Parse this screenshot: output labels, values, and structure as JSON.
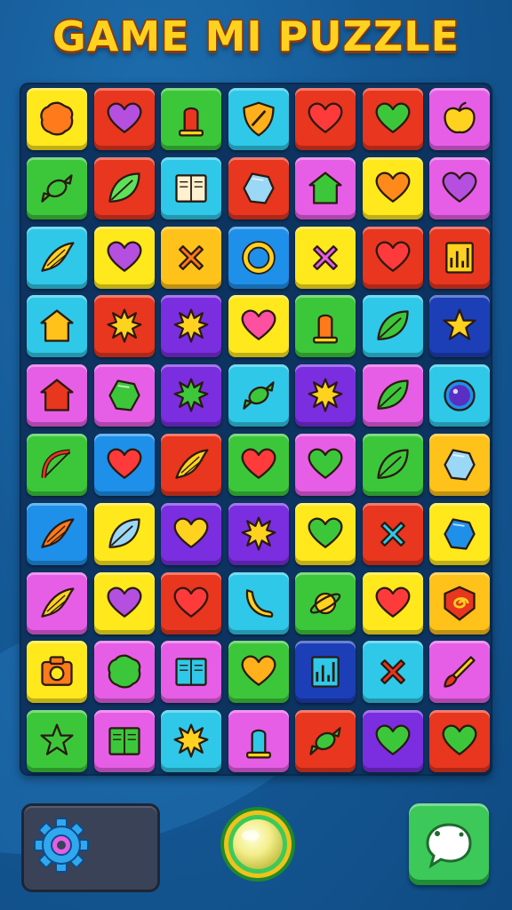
{
  "title": "GAME MI PUZZLE",
  "colors": {
    "yellow": "#ffe81c",
    "red": "#e8361f",
    "green": "#3cc73b",
    "cyan": "#2fc8e8",
    "magenta": "#e65ee6",
    "orange": "#ffc21a",
    "purple": "#7a2ee0",
    "blue": "#1e90ea",
    "navy": "#1c3fb8"
  },
  "grid": [
    [
      {
        "bg": "yellow",
        "icon": "blob-icon",
        "fg": "#ff7a1a"
      },
      {
        "bg": "red",
        "icon": "heart-icon",
        "fg": "#b44fe0"
      },
      {
        "bg": "green",
        "icon": "lamp-icon",
        "fg": "#e8361f"
      },
      {
        "bg": "cyan",
        "icon": "shield-icon",
        "fg": "#ffb01a"
      },
      {
        "bg": "red",
        "icon": "heart-icon",
        "fg": "#ff3a3a"
      },
      {
        "bg": "red",
        "icon": "heart-icon",
        "fg": "#3cc73b"
      },
      {
        "bg": "magenta",
        "icon": "apple-icon",
        "fg": "#ffd21f"
      }
    ],
    [
      {
        "bg": "green",
        "icon": "candy-icon",
        "fg": "#3cc73b"
      },
      {
        "bg": "red",
        "icon": "leaf-icon",
        "fg": "#5ee05a"
      },
      {
        "bg": "cyan",
        "icon": "book-icon",
        "fg": "#fff1d0"
      },
      {
        "bg": "red",
        "icon": "gem-icon",
        "fg": "#9ad8f5"
      },
      {
        "bg": "magenta",
        "icon": "house-icon",
        "fg": "#3cc73b"
      },
      {
        "bg": "yellow",
        "icon": "heart-icon",
        "fg": "#ff8a1a"
      },
      {
        "bg": "magenta",
        "icon": "heart-icon",
        "fg": "#b44fe0"
      }
    ],
    [
      {
        "bg": "cyan",
        "icon": "wing-icon",
        "fg": "#ffd21f"
      },
      {
        "bg": "yellow",
        "icon": "heart-icon",
        "fg": "#b44fe0"
      },
      {
        "bg": "orange",
        "icon": "cross-icon",
        "fg": "#ff7a1a"
      },
      {
        "bg": "blue",
        "icon": "ring-icon",
        "fg": "#ffd21f"
      },
      {
        "bg": "yellow",
        "icon": "cross-icon",
        "fg": "#e65ee6"
      },
      {
        "bg": "red",
        "icon": "heart-icon",
        "fg": "#ff3a3a"
      },
      {
        "bg": "red",
        "icon": "chart-icon",
        "fg": "#ffd21f"
      }
    ],
    [
      {
        "bg": "cyan",
        "icon": "house-icon",
        "fg": "#ffc21a"
      },
      {
        "bg": "red",
        "icon": "sun-icon",
        "fg": "#ffd21f"
      },
      {
        "bg": "purple",
        "icon": "sun-icon",
        "fg": "#ffd21f"
      },
      {
        "bg": "yellow",
        "icon": "heart-icon",
        "fg": "#ff4fa0"
      },
      {
        "bg": "green",
        "icon": "lamp-icon",
        "fg": "#ff7a1a"
      },
      {
        "bg": "cyan",
        "icon": "leaf-icon",
        "fg": "#3cc73b"
      },
      {
        "bg": "navy",
        "icon": "star-icon",
        "fg": "#ffd21f"
      }
    ],
    [
      {
        "bg": "magenta",
        "icon": "house-icon",
        "fg": "#e8361f"
      },
      {
        "bg": "magenta",
        "icon": "gem-icon",
        "fg": "#3cc73b"
      },
      {
        "bg": "purple",
        "icon": "sun-icon",
        "fg": "#3cc73b"
      },
      {
        "bg": "cyan",
        "icon": "candy-icon",
        "fg": "#3cc73b"
      },
      {
        "bg": "purple",
        "icon": "sun-icon",
        "fg": "#ffd21f"
      },
      {
        "bg": "magenta",
        "icon": "leaf-icon",
        "fg": "#3cc73b"
      },
      {
        "bg": "cyan",
        "icon": "orb-icon",
        "fg": "#5a2ec0"
      }
    ],
    [
      {
        "bg": "green",
        "icon": "bow-icon",
        "fg": "#e8361f"
      },
      {
        "bg": "blue",
        "icon": "heart-icon",
        "fg": "#ff3a3a"
      },
      {
        "bg": "red",
        "icon": "wing-icon",
        "fg": "#ffd21f"
      },
      {
        "bg": "green",
        "icon": "heart-icon",
        "fg": "#ff3a3a"
      },
      {
        "bg": "magenta",
        "icon": "heart-icon",
        "fg": "#3cc73b"
      },
      {
        "bg": "green",
        "icon": "leaf-icon",
        "fg": "#3cc73b"
      },
      {
        "bg": "orange",
        "icon": "gem-icon",
        "fg": "#9ad8f5"
      }
    ],
    [
      {
        "bg": "blue",
        "icon": "wing-icon",
        "fg": "#ff7a1a"
      },
      {
        "bg": "yellow",
        "icon": "leaf-icon",
        "fg": "#9ad8f5"
      },
      {
        "bg": "purple",
        "icon": "heart-icon",
        "fg": "#ffd21f"
      },
      {
        "bg": "purple",
        "icon": "sun-icon",
        "fg": "#ffd21f"
      },
      {
        "bg": "yellow",
        "icon": "heart-icon",
        "fg": "#3cc73b"
      },
      {
        "bg": "red",
        "icon": "cross-icon",
        "fg": "#2fc8e8"
      },
      {
        "bg": "yellow",
        "icon": "gem-icon",
        "fg": "#1e90ea"
      }
    ],
    [
      {
        "bg": "magenta",
        "icon": "wing-icon",
        "fg": "#ffd21f"
      },
      {
        "bg": "yellow",
        "icon": "heart-icon",
        "fg": "#b44fe0"
      },
      {
        "bg": "red",
        "icon": "heart-icon",
        "fg": "#ff3a3a"
      },
      {
        "bg": "cyan",
        "icon": "banana-icon",
        "fg": "#ffd21f"
      },
      {
        "bg": "green",
        "icon": "planet-icon",
        "fg": "#ffd21f"
      },
      {
        "bg": "yellow",
        "icon": "heart-icon",
        "fg": "#ff3a3a"
      },
      {
        "bg": "orange",
        "icon": "spiral-icon",
        "fg": "#e8361f"
      }
    ],
    [
      {
        "bg": "yellow",
        "icon": "camera-icon",
        "fg": "#ff7a1a"
      },
      {
        "bg": "magenta",
        "icon": "blob-icon",
        "fg": "#3cc73b"
      },
      {
        "bg": "magenta",
        "icon": "book-icon",
        "fg": "#2fc8e8"
      },
      {
        "bg": "green",
        "icon": "heart-icon",
        "fg": "#ffb01a"
      },
      {
        "bg": "navy",
        "icon": "chart-icon",
        "fg": "#2fc8e8"
      },
      {
        "bg": "cyan",
        "icon": "cross-icon",
        "fg": "#e8361f"
      },
      {
        "bg": "magenta",
        "icon": "brush-icon",
        "fg": "#ffd21f"
      }
    ],
    [
      {
        "bg": "green",
        "icon": "star-icon",
        "fg": "#3cc73b"
      },
      {
        "bg": "magenta",
        "icon": "book-icon",
        "fg": "#3cc73b"
      },
      {
        "bg": "cyan",
        "icon": "sun-icon",
        "fg": "#ffd21f"
      },
      {
        "bg": "magenta",
        "icon": "lamp-icon",
        "fg": "#2fc8e8"
      },
      {
        "bg": "red",
        "icon": "candy-icon",
        "fg": "#3cc73b"
      },
      {
        "bg": "purple",
        "icon": "heart-icon",
        "fg": "#3cc73b"
      },
      {
        "bg": "red",
        "icon": "heart-icon",
        "fg": "#3cc73b"
      }
    ]
  ],
  "controls": {
    "settings_icon": "gear-icon",
    "center_icon": "orb-button-icon",
    "hint_icon": "chat-bubble-icon"
  }
}
